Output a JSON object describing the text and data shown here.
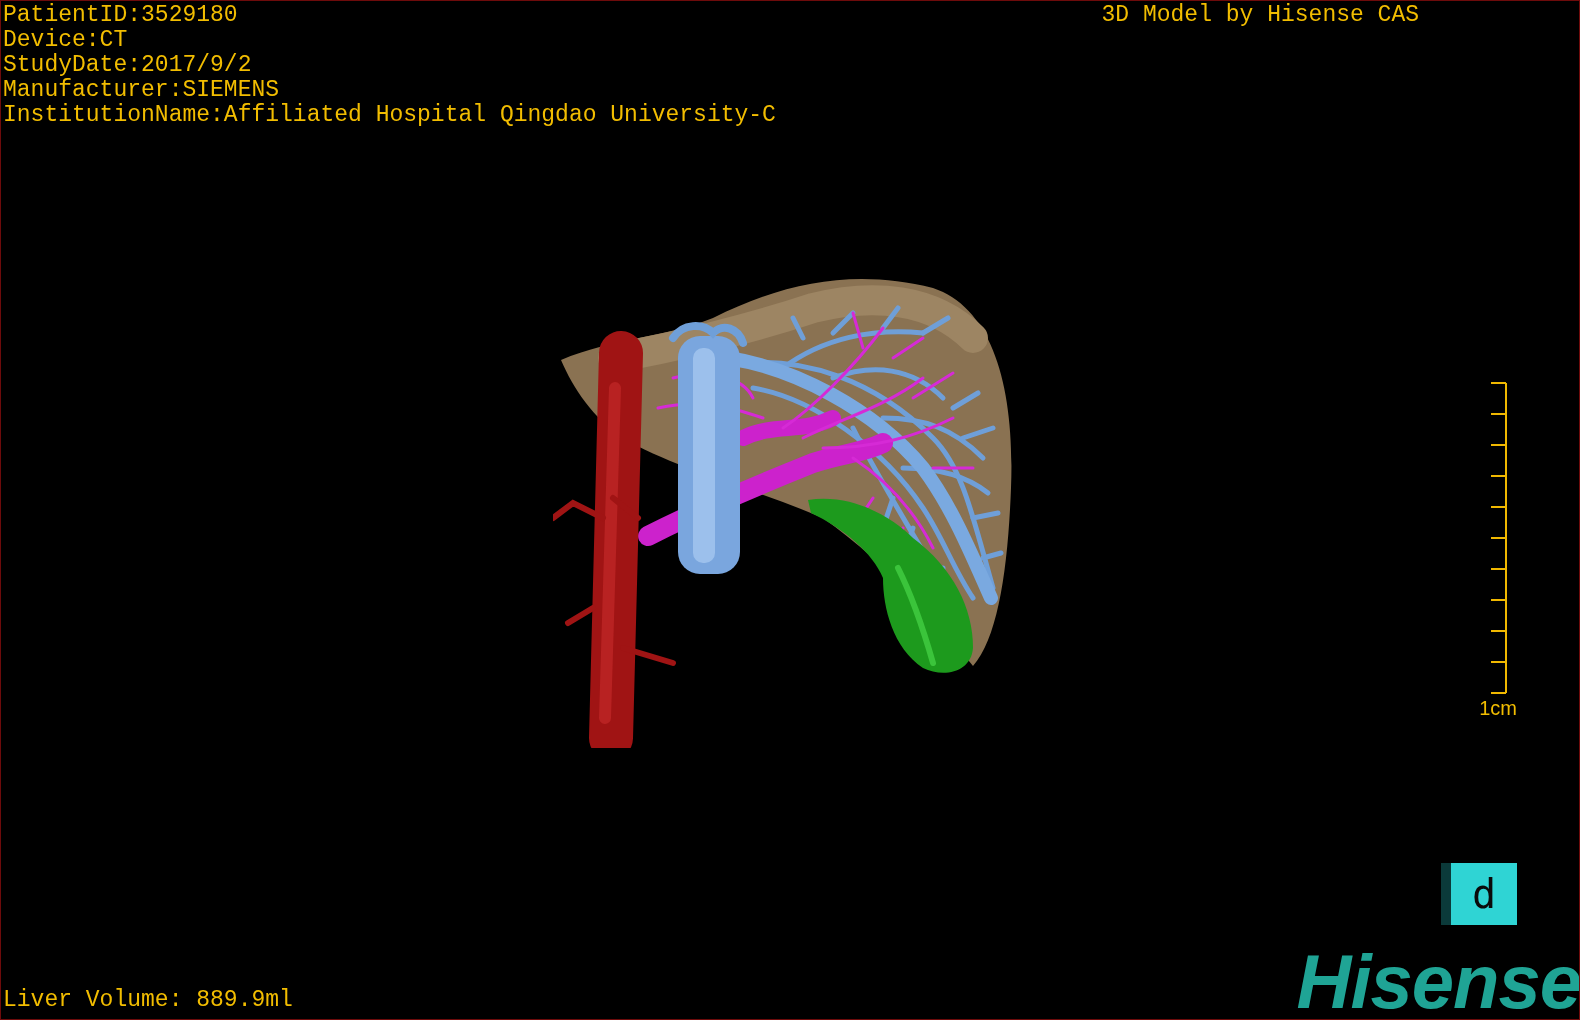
{
  "patient_info": [
    "PatientID:3529180",
    "Device:CT",
    "StudyDate:2017/9/2",
    "Manufacturer:SIEMENS",
    "InstitutionName:Affiliated Hospital Qingdao University-C"
  ],
  "title": "3D Model by Hisense CAS",
  "scale_bar": {
    "label": "1cm"
  },
  "view_button": {
    "label": "d"
  },
  "logo": "Hisense",
  "liver_volume": "Liver Volume: 889.9ml"
}
